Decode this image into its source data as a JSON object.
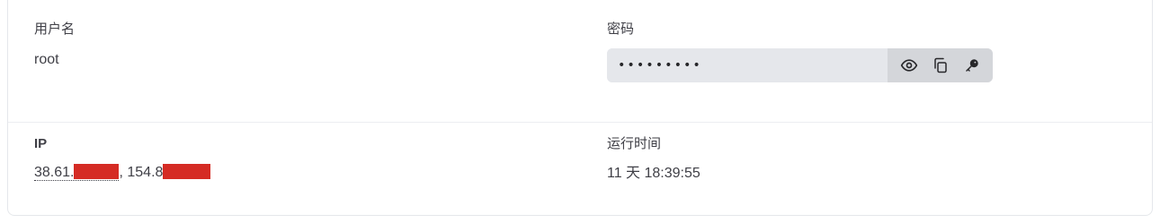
{
  "credentials": {
    "username_label": "用户名",
    "username_value": "root",
    "password_label": "密码",
    "password_value": "•••••••••",
    "actions": {
      "show": "eye-icon",
      "copy": "copy-icon",
      "reset": "key-icon"
    }
  },
  "server": {
    "ip_label": "IP",
    "ip1_prefix": "38.61.",
    "separator": ", ",
    "ip2_prefix": "154.8",
    "uptime_label": "运行时间",
    "uptime_value": "11 天 18:39:55"
  },
  "colors": {
    "redaction": "#d52b24",
    "password_bg": "#e5e7eb",
    "actions_bg": "#d4d6da"
  }
}
